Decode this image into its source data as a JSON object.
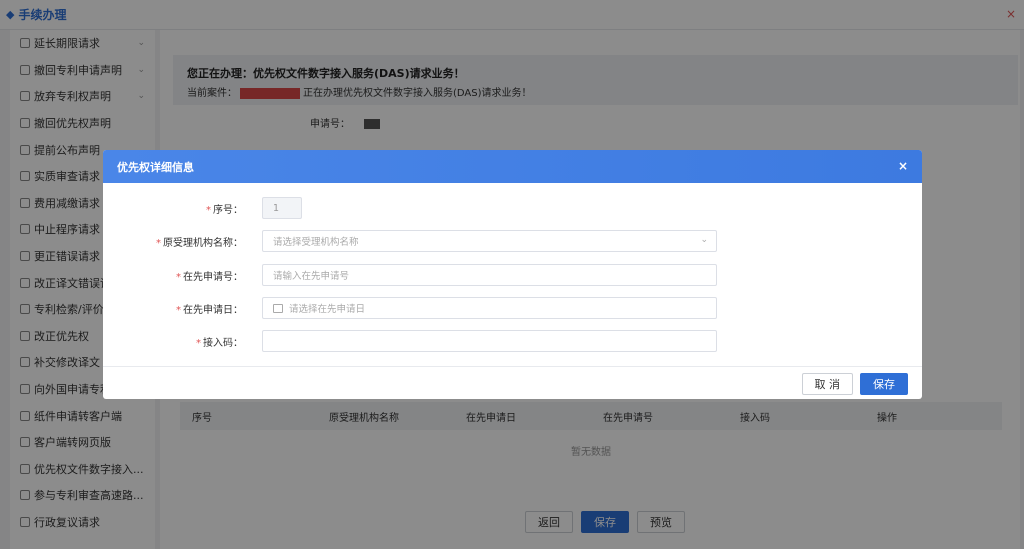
{
  "topbar": {
    "title": "手续办理",
    "close": "×"
  },
  "sidebar": {
    "items": [
      {
        "label": "延长期限请求",
        "has_chevron": true
      },
      {
        "label": "撤回专利申请声明",
        "has_chevron": true
      },
      {
        "label": "放弃专利权声明",
        "has_chevron": true
      },
      {
        "label": "撤回优先权声明",
        "has_chevron": false
      },
      {
        "label": "提前公布声明",
        "has_chevron": false
      },
      {
        "label": "实质审查请求",
        "has_chevron": false
      },
      {
        "label": "费用减缴请求",
        "has_chevron": false
      },
      {
        "label": "中止程序请求",
        "has_chevron": false
      },
      {
        "label": "更正错误请求",
        "has_chevron": false
      },
      {
        "label": "改正译文错误请",
        "has_chevron": false
      },
      {
        "label": "专利检索/评价报",
        "has_chevron": false
      },
      {
        "label": "改正优先权",
        "has_chevron": false
      },
      {
        "label": "补交修改译文",
        "has_chevron": false
      },
      {
        "label": "向外国申请专利",
        "has_chevron": false
      },
      {
        "label": "纸件申请转客户端",
        "has_chevron": false
      },
      {
        "label": "客户端转网页版",
        "has_chevron": false
      },
      {
        "label": "优先权文件数字接入...",
        "has_chevron": false
      },
      {
        "label": "参与专利审查高速路...",
        "has_chevron": false
      },
      {
        "label": "行政复议请求",
        "has_chevron": false
      }
    ]
  },
  "notice": {
    "line1": "您正在办理：优先权文件数字接入服务(DAS)请求业务！",
    "line2_prefix": "当前案件：",
    "line2_suffix": "正在办理优先权文件数字接入服务(DAS)请求业务！"
  },
  "background_field": {
    "label": "申请号："
  },
  "table": {
    "headers": [
      "序号",
      "原受理机构名称",
      "在先申请日",
      "在先申请号",
      "接入码",
      "操作"
    ],
    "empty_text": "暂无数据"
  },
  "footer": {
    "back": "返回",
    "save": "保存",
    "preview": "预览"
  },
  "modal": {
    "title": "优先权详细信息",
    "close": "×",
    "fields": {
      "seq": {
        "label": "序号：",
        "value": "1"
      },
      "office": {
        "label": "原受理机构名称：",
        "placeholder": "请选择受理机构名称"
      },
      "app_no": {
        "label": "在先申请号：",
        "placeholder": "请输入在先申请号"
      },
      "app_date": {
        "label": "在先申请日：",
        "placeholder": "请选择在先申请日"
      },
      "access_code": {
        "label": "接入码：",
        "value": ""
      }
    },
    "cancel": "取 消",
    "save": "保存"
  }
}
